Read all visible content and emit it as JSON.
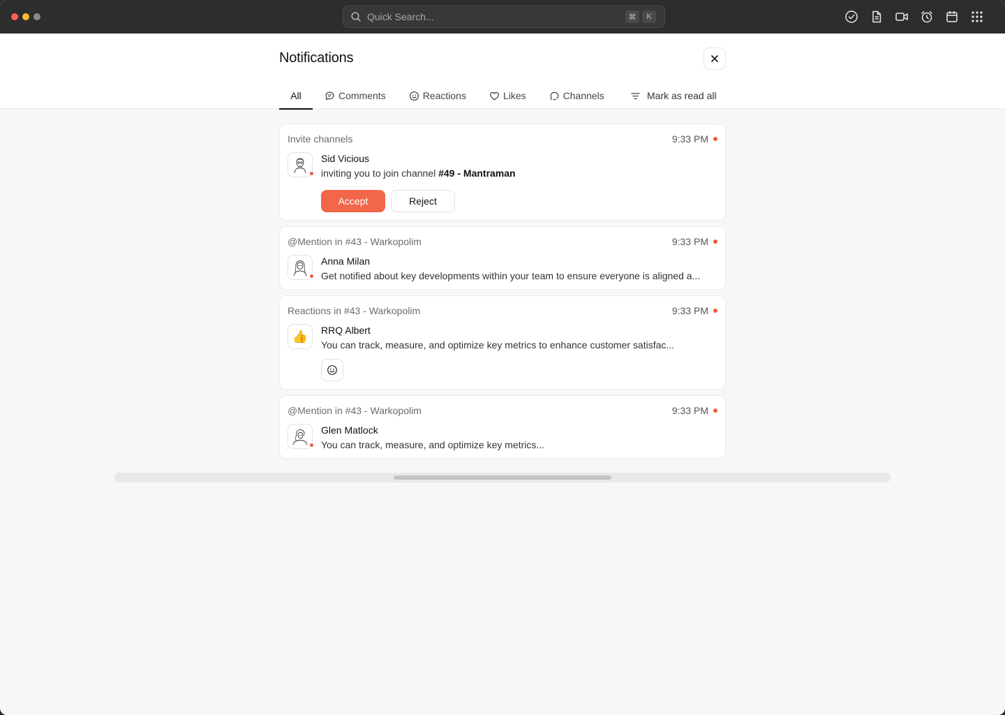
{
  "window": {
    "traffic_colors": [
      "#ff5f57",
      "#febc2e",
      "#8a8a8a"
    ]
  },
  "toolbar": {
    "search_placeholder": "Quick Search...",
    "shortcut_keys": [
      "⌘",
      "K"
    ],
    "icons": [
      "check-circle-icon",
      "document-icon",
      "video-icon",
      "alarm-icon",
      "calendar-icon",
      "apps-grid-icon"
    ]
  },
  "panel": {
    "title": "Notifications",
    "close_icon": "close-icon"
  },
  "tabs": [
    {
      "label": "All",
      "icon": null,
      "active": true
    },
    {
      "label": "Comments",
      "icon": "comment-icon",
      "active": false
    },
    {
      "label": "Reactions",
      "icon": "smile-icon",
      "active": false
    },
    {
      "label": "Likes",
      "icon": "heart-icon",
      "active": false
    },
    {
      "label": "Channels",
      "icon": "channel-icon",
      "active": false
    }
  ],
  "mark_all_read": {
    "label": "Mark as read all",
    "icon": "filter-lines-icon"
  },
  "notifications": [
    {
      "context": "Invite channels",
      "time": "9:33 PM",
      "unread": true,
      "sender": "Sid Vicious",
      "message_prefix": "inviting you to join channel ",
      "message_strong": "#49 - Mantraman",
      "actions": {
        "accept": "Accept",
        "reject": "Reject"
      }
    },
    {
      "context": "@Mention in #43 - Warkopolim",
      "time": "9:33 PM",
      "unread": true,
      "sender": "Anna Milan",
      "message": "Get notified about key developments within your team to ensure everyone is aligned a..."
    },
    {
      "context": "Reactions in #43 - Warkopolim",
      "time": "9:33 PM",
      "unread": true,
      "sender": "RRQ Albert",
      "reaction": "👍",
      "message": "You can track, measure, and optimize key metrics to enhance customer satisfac...",
      "add_reaction_icon": "smile-add-icon"
    },
    {
      "context": "@Mention in #43 - Warkopolim",
      "time": "9:33 PM",
      "unread": true,
      "sender": "Glen Matlock",
      "message": "You can track, measure, and optimize key metrics..."
    }
  ],
  "colors": {
    "accent": "#f2664a",
    "unread_dot": "#f05a3c",
    "titlebar": "#2d2d2d"
  }
}
